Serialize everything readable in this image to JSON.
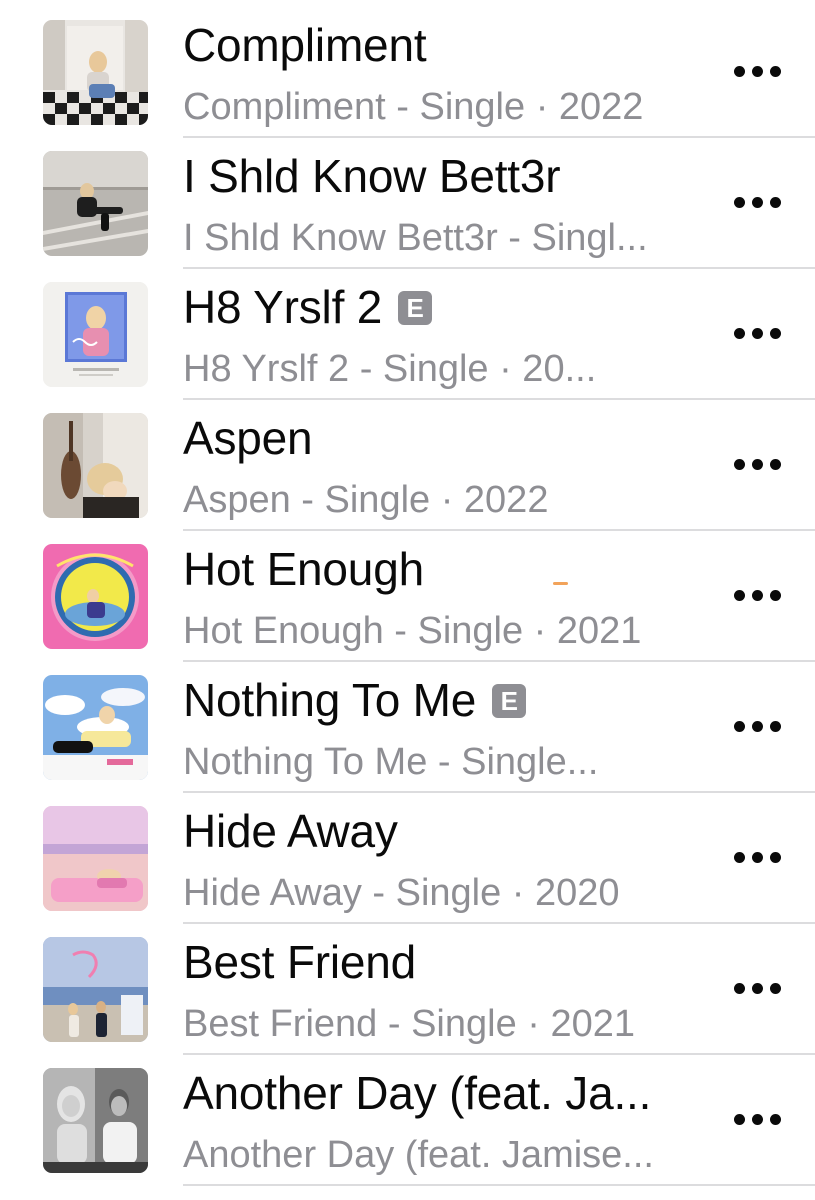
{
  "explicit_label": "E",
  "more_icon": "ellipsis-icon",
  "colors": {
    "title": "#0a0a0a",
    "subtitle": "#8e8e93",
    "badge": "#8e8e93",
    "separator": "#dcdcde"
  },
  "songs": [
    {
      "title": "Compliment",
      "subtitle": "Compliment - Single · 2022",
      "explicit": false
    },
    {
      "title": "I Shld Know Bett3r",
      "subtitle": "I Shld Know Bett3r - Singl...",
      "explicit": false
    },
    {
      "title": "H8 Yrslf 2",
      "subtitle": "H8 Yrslf 2 - Single · 20...",
      "explicit": true
    },
    {
      "title": "Aspen",
      "subtitle": "Aspen - Single · 2022",
      "explicit": false
    },
    {
      "title": "Hot Enough",
      "subtitle": "Hot Enough - Single · 2021",
      "explicit": false
    },
    {
      "title": "Nothing To Me",
      "subtitle": "Nothing To Me - Single...",
      "explicit": true
    },
    {
      "title": "Hide Away",
      "subtitle": "Hide Away - Single · 2020",
      "explicit": false
    },
    {
      "title": "Best Friend",
      "subtitle": "Best Friend - Single · 2021",
      "explicit": false
    },
    {
      "title": "Another Day (feat. Ja...",
      "subtitle": "Another Day (feat. Jamise...",
      "explicit": false
    }
  ]
}
